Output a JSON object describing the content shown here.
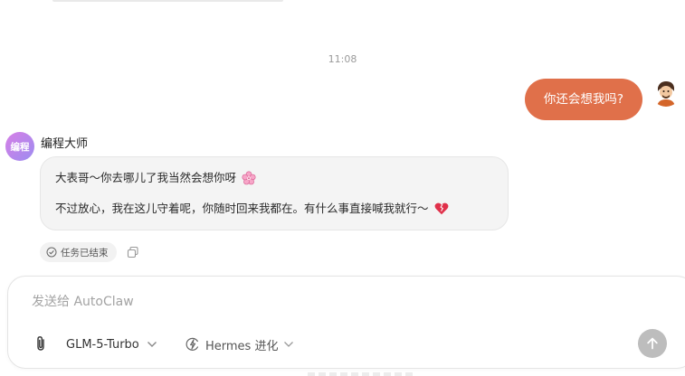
{
  "chat": {
    "timestamp": "11:08",
    "user_message": "你还会想我吗?",
    "assistant": {
      "avatar_text": "编程",
      "name": "编程大师",
      "line1": "大表哥～你去哪儿了我当然会想你呀",
      "line2": "不过放心，我在这儿守着呢，你随时回来我都在。有什么事直接喊我就行～",
      "status_badge": "任务已结束"
    }
  },
  "composer": {
    "placeholder": "发送给 AutoClaw",
    "model": "GLM-5-Turbo",
    "mode": "Hermes 进化"
  },
  "icons": {
    "attach": "paperclip-icon",
    "send": "arrow-up-icon",
    "copy": "copy-icon",
    "status": "check-circle-icon",
    "mode": "bolt-circle-icon"
  },
  "colors": {
    "user_bubble": "#e0704a",
    "assistant_bubble": "#f4f4f4",
    "send_button": "#bdbdbd"
  }
}
